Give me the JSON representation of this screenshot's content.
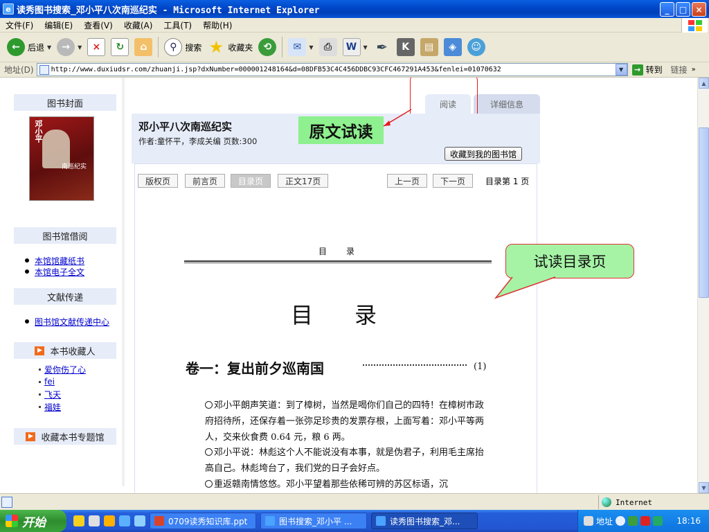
{
  "window": {
    "title": "读秀图书搜索_邓小平八次南巡纪实 - Microsoft Internet Explorer",
    "minimize": "_",
    "maximize": "□",
    "close": "×"
  },
  "menu": {
    "items": [
      "文件(F)",
      "编辑(E)",
      "查看(V)",
      "收藏(A)",
      "工具(T)",
      "帮助(H)"
    ]
  },
  "toolbar": {
    "back": "后退",
    "search": "搜索",
    "favorites": "收藏夹"
  },
  "address": {
    "label": "地址(D)",
    "url": "http://www.duxiudsr.com/zhuanji.jsp?dxNumber=000001248164&d=08DFB53C4C456DDBC93CFC467291A453&fenlei=01070632",
    "go": "转到",
    "links": "链接"
  },
  "sidebar": {
    "cover_head": "图书封面",
    "cover_author": "邓小平",
    "cover_title": "南巡纪实",
    "borrow_head": "图书馆借阅",
    "borrow_items": [
      "本馆馆藏纸书",
      "本馆电子全文"
    ],
    "delivery_head": "文献传递",
    "delivery_items": [
      "图书馆文献传递中心"
    ],
    "collectors_head": "本书收藏人",
    "collectors": [
      "爱你伤了心",
      "fei",
      "飞天",
      "福娃"
    ],
    "collect_topic": "收藏本书专题馆"
  },
  "tabs": {
    "read": "阅读",
    "detail": "详细信息"
  },
  "book": {
    "title": "邓小平八次南巡纪实",
    "meta": "作者:童怀平，李成关编   页数:300",
    "fav_button": "收藏到我的图书馆"
  },
  "annotations": {
    "green_label": "原文试读",
    "bubble_label": "试读目录页"
  },
  "reader": {
    "nav": [
      "版权页",
      "前言页",
      "目录页",
      "正文17页"
    ],
    "active_nav": "目录页",
    "prev": "上一页",
    "next": "下一页",
    "page_indicator": "目录第 1 页"
  },
  "scan": {
    "small_head": "目录",
    "big_head": "目录",
    "chapter": "卷一：复出前夕巡南国",
    "chapter_page": "(1)",
    "para1": "邓小平朗声笑道：到了樟树，当然是喝你们自己的四特！在樟树市政府招待所，还保存着一张弥足珍贵的发票存根，上面写着：邓小平等两人，交来伙食费 0.64 元，粮 6 两。",
    "para2": "邓小平说：林彪这个人不能说没有本事，就是伪君子，利用毛主席抬高自己。林彪垮台了，我们党的日子会好点。",
    "para3": "重返赣南情悠悠。邓小平望着那些依稀可辨的苏区标语，沉"
  },
  "statusbar": {
    "zone": "Internet"
  },
  "taskbar": {
    "start": "开始",
    "tasks": [
      "0709读秀知识库.ppt",
      "图书搜索_邓小平 ...",
      "读秀图书搜索_邓..."
    ],
    "tray_label": "地址",
    "clock": "18:16"
  }
}
